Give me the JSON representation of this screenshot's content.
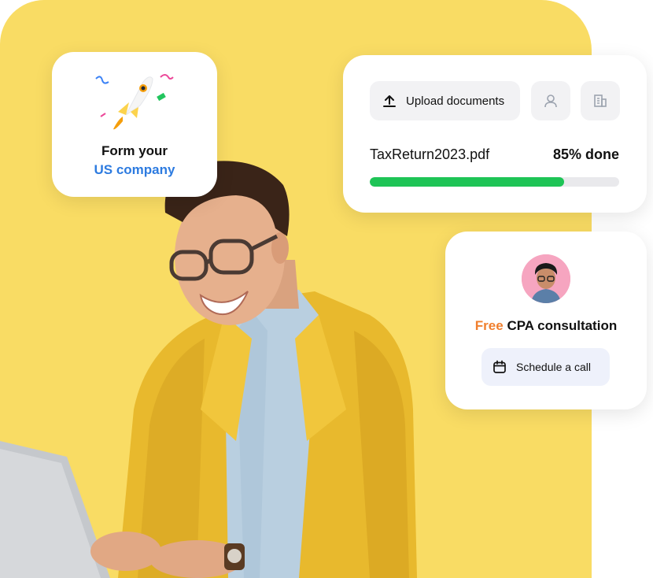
{
  "form_card": {
    "title": "Form your",
    "subtitle": "US company",
    "icon": "rocket-icon"
  },
  "upload_card": {
    "upload_label": "Upload documents",
    "icons": [
      "upload-icon",
      "user-icon",
      "building-icon"
    ],
    "file": {
      "name": "TaxReturn2023.pdf",
      "progress_text": "85% done",
      "progress_fraction": 0.78
    }
  },
  "cpa_card": {
    "free_label": "Free",
    "title_rest": "CPA consultation",
    "schedule_label": "Schedule a call",
    "icons": [
      "avatar",
      "calendar-icon"
    ]
  },
  "colors": {
    "background_yellow": "#f9dc64",
    "accent_blue": "#2d7be0",
    "accent_orange": "#f07f2e",
    "progress_green": "#1ec456"
  }
}
